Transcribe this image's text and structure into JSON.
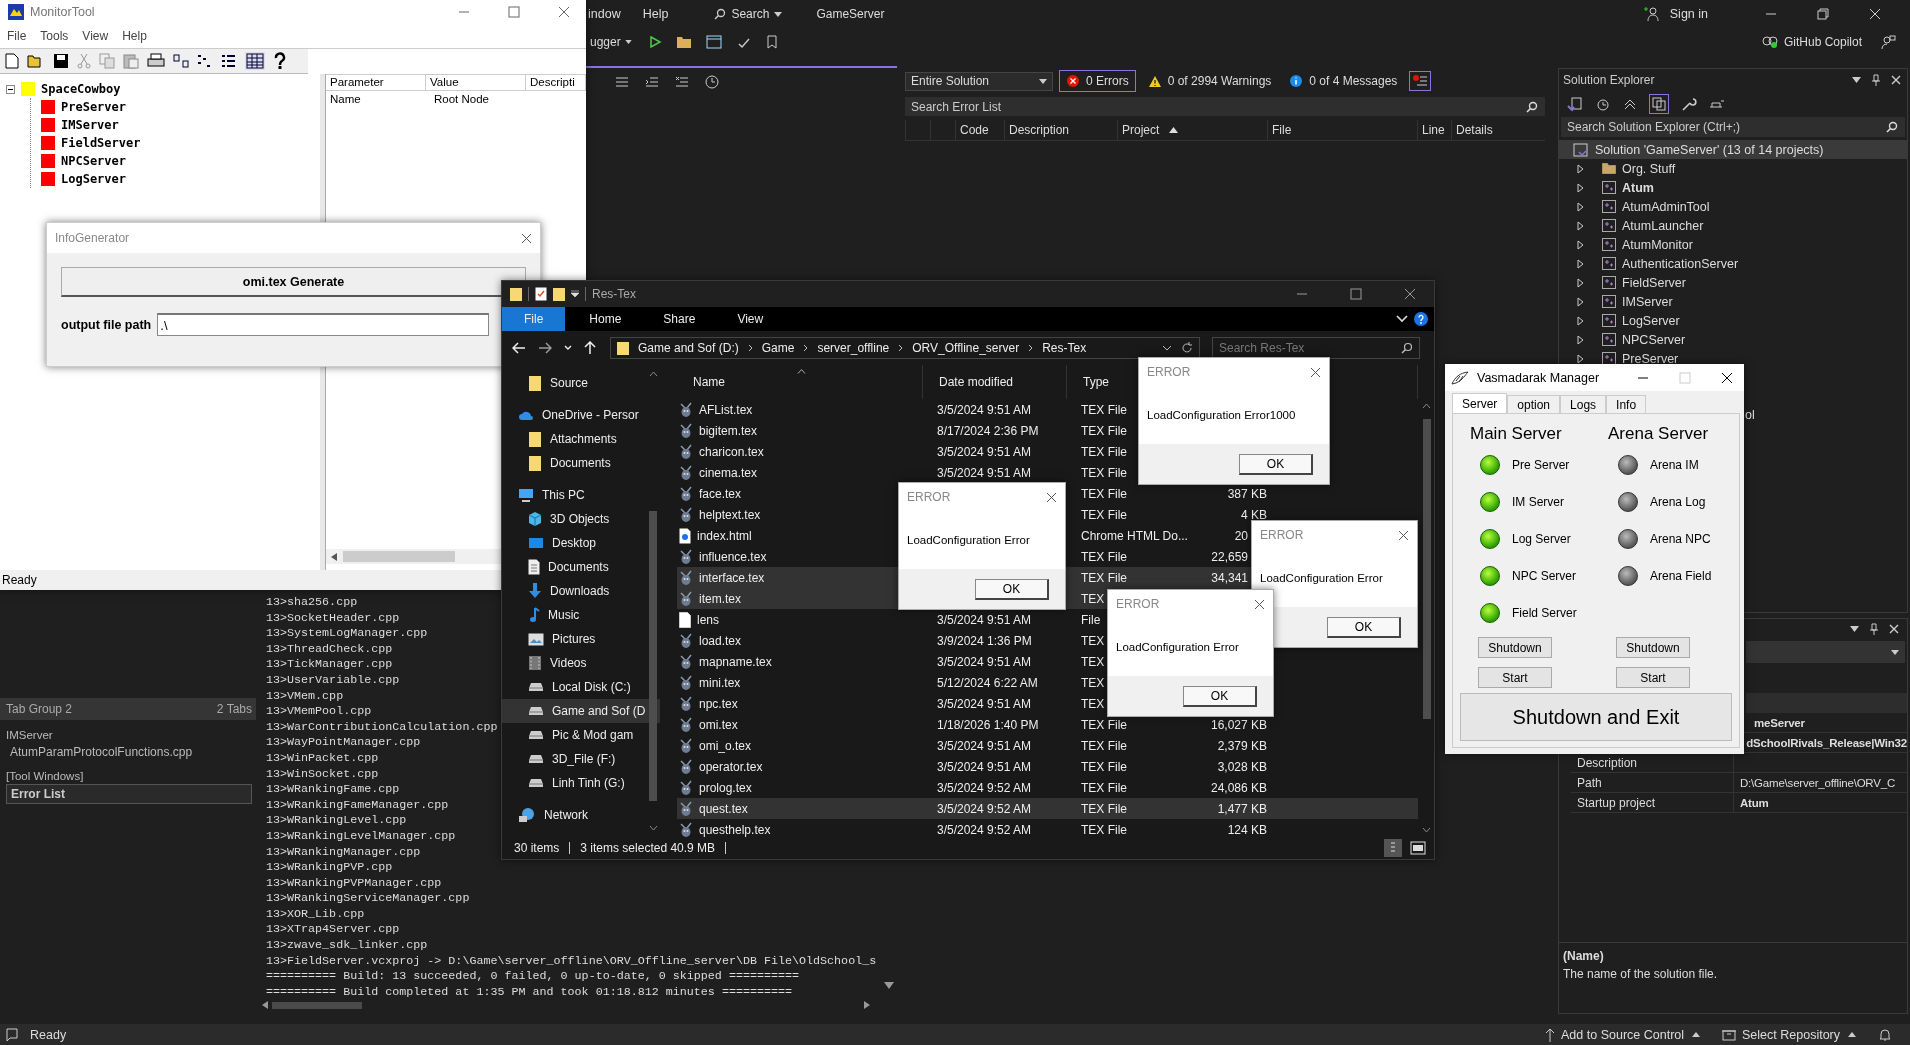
{
  "vs": {
    "menu": [
      "indow",
      "Help"
    ],
    "search": "Search",
    "solution_name": "GameServer",
    "sign_in": "Sign in",
    "toolbar_dropdown": "ugger",
    "copilot": "GitHub Copilot",
    "error_list": {
      "scope": "Entire Solution",
      "errors": "0 Errors",
      "warnings": "0 of 2994 Warnings",
      "messages": "0 of 4 Messages",
      "search_placeholder": "Search Error List",
      "columns": [
        "Code",
        "Description",
        "Project",
        "File",
        "Line",
        "Details"
      ]
    },
    "solution_explorer": {
      "title": "Solution Explorer",
      "search_placeholder": "Search Solution Explorer (Ctrl+;)",
      "solution": "Solution 'GameServer' (13 of 14 projects)",
      "items": [
        {
          "label": "Org. Stuff",
          "kind": "folder",
          "startup": false
        },
        {
          "label": "Atum",
          "kind": "project",
          "startup": true
        },
        {
          "label": "AtumAdminTool",
          "kind": "project",
          "startup": false
        },
        {
          "label": "AtumLauncher",
          "kind": "project",
          "startup": false
        },
        {
          "label": "AtumMonitor",
          "kind": "project",
          "startup": false
        },
        {
          "label": "AuthenticationServer",
          "kind": "project",
          "startup": false
        },
        {
          "label": "FieldServer",
          "kind": "project",
          "startup": false
        },
        {
          "label": "IMServer",
          "kind": "project",
          "startup": false
        },
        {
          "label": "LogServer",
          "kind": "project",
          "startup": false
        },
        {
          "label": "NPCServer",
          "kind": "project",
          "startup": false
        },
        {
          "label": "PreServer",
          "kind": "project",
          "startup": false
        }
      ],
      "hidden_item_tail": "ol"
    },
    "properties": {
      "rows": [
        {
          "value": "meServer",
          "bold": true
        },
        {
          "value": "dSchoolRivals_Release|Win32",
          "bold": true
        },
        {
          "label": "Description"
        },
        {
          "label": "Path",
          "value": "D:\\Game\\server_offline\\ORV_C",
          "bold": false
        },
        {
          "label": "Startup project",
          "value": "Atum",
          "bold": true
        }
      ],
      "help_title": "(Name)",
      "help_text": "The name of the solution file."
    },
    "tab_group": {
      "title": "Tab Group 2",
      "count": "2 Tabs",
      "groups": [
        {
          "heading": "IMServer",
          "items": [
            {
              "label": "AtumParamProtocolFunctions.cpp",
              "selected": false
            }
          ]
        },
        {
          "heading": "[Tool Windows]",
          "items": [
            {
              "label": "Error List",
              "selected": true
            }
          ]
        }
      ]
    },
    "output_lines": [
      "13>sha256.cpp",
      "13>SocketHeader.cpp",
      "13>SystemLogManager.cpp",
      "13>ThreadCheck.cpp",
      "13>TickManager.cpp",
      "13>UserVariable.cpp",
      "13>VMem.cpp",
      "13>VMemPool.cpp",
      "13>WarContributionCalculation.cpp",
      "13>WayPointManager.cpp",
      "13>WinPacket.cpp",
      "13>WinSocket.cpp",
      "13>WRankingFame.cpp",
      "13>WRankingFameManager.cpp",
      "13>WRankingLevel.cpp",
      "13>WRankingLevelManager.cpp",
      "13>WRankingManager.cpp",
      "13>WRankingPVP.cpp",
      "13>WRankingPVPManager.cpp",
      "13>WRankingServiceManager.cpp",
      "13>XOR_Lib.cpp",
      "13>XTrap4Server.cpp",
      "13>zwave_sdk_linker.cpp",
      "13>FieldServer.vcxproj -> D:\\Game\\server_offline\\ORV_Offline_server\\DB File\\OldSchool_s",
      "========== Build: 13 succeeded, 0 failed, 0 up-to-date, 0 skipped ==========",
      "========== Build completed at 1:35 PM and took 01:18.812 minutes =========="
    ],
    "status": "Ready",
    "source_control": "Add to Source Control",
    "repository": "Select Repository"
  },
  "monitor_tool": {
    "title": "MonitorTool",
    "menu": [
      "File",
      "Tools",
      "View",
      "Help"
    ],
    "tree": {
      "label": "SpaceCowboy",
      "color": "#ffff00",
      "expanded": true,
      "children": [
        {
          "label": "PreServer",
          "color": "#ff0000"
        },
        {
          "label": "IMServer",
          "color": "#ff0000"
        },
        {
          "label": "FieldServer",
          "color": "#ff0000"
        },
        {
          "label": "NPCServer",
          "color": "#ff0000"
        },
        {
          "label": "LogServer",
          "color": "#ff0000"
        }
      ]
    },
    "columns": [
      "Parameter",
      "Value",
      "Descripti"
    ],
    "rows": [
      {
        "parameter": "Name",
        "value": "Root Node"
      }
    ],
    "status": "Ready"
  },
  "info_generator": {
    "title": "InfoGenerator",
    "button": "omi.tex Generate",
    "field_label": "output file path",
    "field_value": ".\\"
  },
  "explorer": {
    "title": "Res-Tex",
    "ribbon_tabs": [
      {
        "label": "File",
        "selected": true
      },
      {
        "label": "Home",
        "selected": false
      },
      {
        "label": "Share",
        "selected": false
      },
      {
        "label": "View",
        "selected": false
      }
    ],
    "breadcrumb": [
      "Game and Sof (D:)",
      "Game",
      "server_offline",
      "ORV_Offline_server",
      "Res-Tex"
    ],
    "search_placeholder": "Search Res-Tex",
    "nav": [
      {
        "label": "Source",
        "kind": "folder",
        "selected": false
      },
      {
        "label": "OneDrive - Persor",
        "kind": "cloud",
        "selected": false,
        "children": [
          {
            "label": "Attachments",
            "kind": "folder",
            "selected": false
          },
          {
            "label": "Documents",
            "kind": "folder",
            "selected": false
          }
        ]
      },
      {
        "label": "This PC",
        "kind": "pc",
        "selected": false,
        "children": [
          {
            "label": "3D Objects",
            "kind": "cube",
            "selected": false
          },
          {
            "label": "Desktop",
            "kind": "desktop",
            "selected": false
          },
          {
            "label": "Documents",
            "kind": "document",
            "selected": false
          },
          {
            "label": "Downloads",
            "kind": "download",
            "selected": false
          },
          {
            "label": "Music",
            "kind": "music",
            "selected": false
          },
          {
            "label": "Pictures",
            "kind": "picture",
            "selected": false
          },
          {
            "label": "Videos",
            "kind": "video",
            "selected": false
          },
          {
            "label": "Local Disk (C:)",
            "kind": "drive",
            "selected": false
          },
          {
            "label": "Game and Sof (D",
            "kind": "drive",
            "selected": true
          },
          {
            "label": "Pic & Mod gam",
            "kind": "drive",
            "selected": false
          },
          {
            "label": "3D_File (F:)",
            "kind": "drive",
            "selected": false
          },
          {
            "label": "Linh Tinh (G:)",
            "kind": "drive",
            "selected": false
          }
        ]
      },
      {
        "label": "Network",
        "kind": "network",
        "selected": false
      }
    ],
    "columns": [
      "Name",
      "Date modified",
      "Type"
    ],
    "files": [
      {
        "name": "AFList.tex",
        "kind": "tex",
        "date": "3/5/2024 9:51 AM",
        "type": "TEX File",
        "selected": false
      },
      {
        "name": "bigitem.tex",
        "kind": "tex",
        "date": "8/17/2024 2:36 PM",
        "type": "TEX File",
        "selected": false
      },
      {
        "name": "charicon.tex",
        "kind": "tex",
        "date": "3/5/2024 9:51 AM",
        "type": "TEX File",
        "selected": false
      },
      {
        "name": "cinema.tex",
        "kind": "tex",
        "date": "3/5/2024 9:51 AM",
        "type": "TEX File",
        "selected": false
      },
      {
        "name": "face.tex",
        "kind": "tex",
        "type": "TEX File",
        "size": "387 KB",
        "selected": false
      },
      {
        "name": "helptext.tex",
        "kind": "tex",
        "type": "TEX File",
        "size": "4 KB",
        "selected": false
      },
      {
        "name": "index.html",
        "kind": "html",
        "type": "Chrome HTML Do...",
        "size": "20",
        "size_cut": true,
        "selected": false
      },
      {
        "name": "influence.tex",
        "kind": "tex",
        "type": "TEX File",
        "size": "22,659",
        "size_cut": true,
        "selected": false
      },
      {
        "name": "interface.tex",
        "kind": "tex",
        "type": "TEX File",
        "size": "34,341",
        "size_cut": true,
        "selected": true
      },
      {
        "name": "item.tex",
        "kind": "tex",
        "type": "TEX",
        "selected": true
      },
      {
        "name": "lens",
        "kind": "blank",
        "date": "3/5/2024 9:51 AM",
        "type": "File",
        "selected": false
      },
      {
        "name": "load.tex",
        "kind": "tex",
        "date": "3/9/2024 1:36 PM",
        "type": "TEX",
        "selected": false
      },
      {
        "name": "mapname.tex",
        "kind": "tex",
        "date": "3/5/2024 9:51 AM",
        "type": "TEX",
        "selected": false
      },
      {
        "name": "mini.tex",
        "kind": "tex",
        "date": "5/12/2024 6:22 AM",
        "type": "TEX",
        "selected": false
      },
      {
        "name": "npc.tex",
        "kind": "tex",
        "date": "3/5/2024 9:51 AM",
        "type": "TEX",
        "selected": false
      },
      {
        "name": "omi.tex",
        "kind": "tex",
        "date": "1/18/2026 1:40 PM",
        "type": "TEX File",
        "size": "16,027 KB",
        "selected": false
      },
      {
        "name": "omi_o.tex",
        "kind": "tex",
        "date": "3/5/2024 9:51 AM",
        "type": "TEX File",
        "size": "2,379 KB",
        "selected": false
      },
      {
        "name": "operator.tex",
        "kind": "tex",
        "date": "3/5/2024 9:51 AM",
        "type": "TEX File",
        "size": "3,028 KB",
        "selected": false
      },
      {
        "name": "prolog.tex",
        "kind": "tex",
        "date": "3/5/2024 9:52 AM",
        "type": "TEX File",
        "size": "24,086 KB",
        "selected": false
      },
      {
        "name": "quest.tex",
        "kind": "tex",
        "date": "3/5/2024 9:52 AM",
        "type": "TEX File",
        "size": "1,477 KB",
        "selected": true
      },
      {
        "name": "questhelp.tex",
        "kind": "tex",
        "date": "3/5/2024 9:52 AM",
        "type": "TEX File",
        "size": "124 KB",
        "selected": false
      }
    ],
    "item_count": "30 items",
    "selection": "3 items selected  40.9 MB"
  },
  "error_dialogs": [
    {
      "title": "ERROR",
      "message": "LoadConfiguration Error1000",
      "button": "OK"
    },
    {
      "title": "ERROR",
      "message": "LoadConfiguration Error",
      "button": "OK"
    },
    {
      "title": "ERROR",
      "message": "LoadConfiguration Error",
      "button": "OK"
    },
    {
      "title": "ERROR",
      "message": "LoadConfiguration Error",
      "button": "OK"
    }
  ],
  "manager": {
    "title": "Vasmadarak Manager",
    "tabs": [
      {
        "label": "Server",
        "selected": true
      },
      {
        "label": "option",
        "selected": false
      },
      {
        "label": "Logs",
        "selected": false
      },
      {
        "label": "Info",
        "selected": false
      }
    ],
    "groups": [
      {
        "heading": "Main Server",
        "servers": [
          {
            "label": "Pre Server",
            "on": true
          },
          {
            "label": "IM Server",
            "on": true
          },
          {
            "label": "Log Server",
            "on": true
          },
          {
            "label": "NPC Server",
            "on": true
          },
          {
            "label": "Field Server",
            "on": true
          }
        ],
        "buttons": [
          "Shutdown",
          "Start"
        ]
      },
      {
        "heading": "Arena Server",
        "servers": [
          {
            "label": "Arena IM",
            "on": false
          },
          {
            "label": "Arena Log",
            "on": false
          },
          {
            "label": "Arena NPC",
            "on": false
          },
          {
            "label": "Arena Field",
            "on": false
          }
        ],
        "buttons": [
          "Shutdown",
          "Start"
        ]
      }
    ],
    "exit_button": "Shutdown and Exit"
  }
}
